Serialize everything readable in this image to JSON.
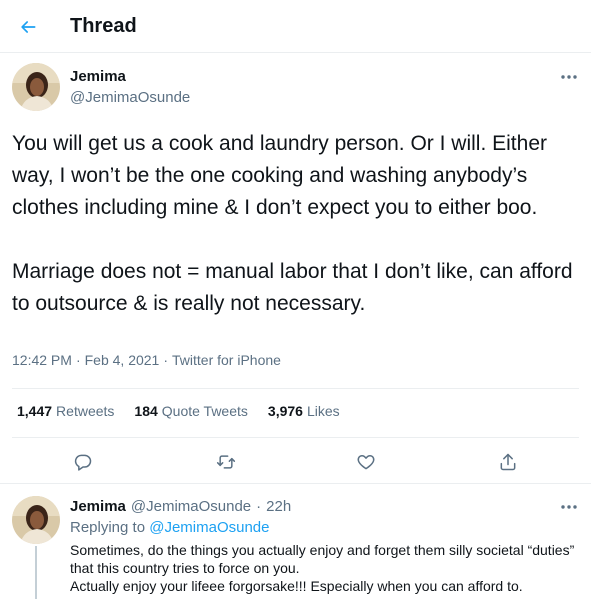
{
  "header": {
    "title": "Thread",
    "back_icon": "arrow-left-icon"
  },
  "tweet": {
    "author_name": "Jemima",
    "author_handle": "@JemimaOsunde",
    "text": "You will get us a cook and laundry person. Or I will. Either way, I won’t be the one cooking and washing anybody’s clothes including mine & I don’t expect you to either boo.\n\nMarriage does not = manual labor that I don’t like, can afford to outsource & is really not necessary.",
    "time": "12:42 PM",
    "separator": "·",
    "date": "Feb 4, 2021",
    "source": "Twitter for iPhone",
    "stats": {
      "retweets_count": "1,447",
      "retweets_label": "Retweets",
      "quotes_count": "184",
      "quotes_label": "Quote Tweets",
      "likes_count": "3,976",
      "likes_label": "Likes"
    },
    "actions": [
      "reply-icon",
      "retweet-icon",
      "like-icon",
      "share-icon"
    ]
  },
  "reply": {
    "author_name": "Jemima",
    "author_handle": "@JemimaOsunde",
    "separator": "·",
    "age": "22h",
    "replying_label": "Replying to",
    "replying_to": "@JemimaOsunde",
    "text_line1": "Sometimes, do the things you actually enjoy and forget them silly societal “duties” that this country tries to force on you.",
    "text_line2": "Actually enjoy your lifeee forgorsake!!! Especially when you can afford to."
  },
  "colors": {
    "accent": "#1da1f2",
    "text_primary": "#0f1419",
    "text_secondary": "#5b7083",
    "border": "#ebeef0"
  }
}
